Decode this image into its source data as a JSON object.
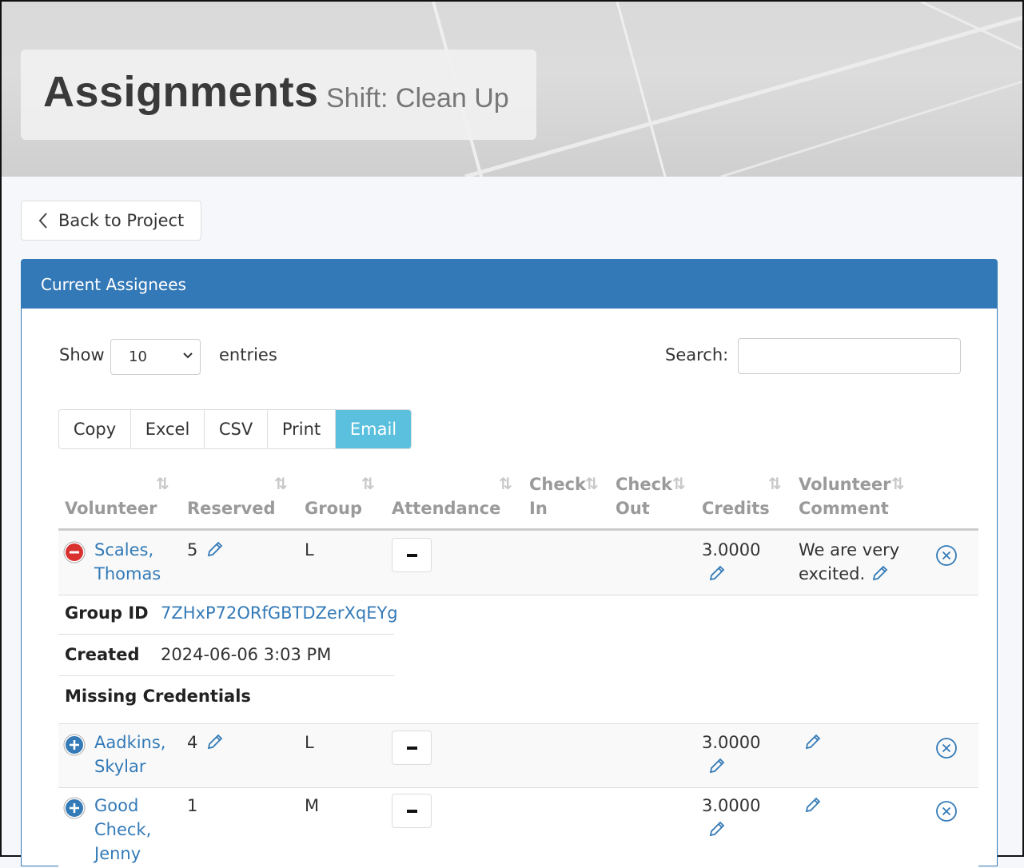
{
  "header": {
    "title": "Assignments",
    "subtitle": "Shift: Clean Up"
  },
  "nav": {
    "back_label": "Back to Project"
  },
  "panel": {
    "title": "Current Assignees"
  },
  "controls": {
    "show_label": "Show",
    "show_value": "10",
    "entries_label": "entries",
    "search_label": "Search:",
    "search_value": ""
  },
  "export_buttons": [
    {
      "label": "Copy"
    },
    {
      "label": "Excel"
    },
    {
      "label": "CSV"
    },
    {
      "label": "Print"
    },
    {
      "label": "Email",
      "active": true
    }
  ],
  "columns": [
    {
      "line1": "",
      "line2": "Volunteer"
    },
    {
      "line1": "",
      "line2": "Reserved"
    },
    {
      "line1": "",
      "line2": "Group"
    },
    {
      "line1": "",
      "line2": "Attendance"
    },
    {
      "line1": "Check",
      "line2": "In"
    },
    {
      "line1": "Check",
      "line2": "Out"
    },
    {
      "line1": "",
      "line2": "Credits"
    },
    {
      "line1": "Volunteer",
      "line2": "Comment"
    }
  ],
  "rows": [
    {
      "name_line1": "Scales,",
      "name_line2": "Thomas",
      "reserved": "5",
      "group": "L",
      "credits": "3.0000",
      "comment_line1": "We are very",
      "comment_line2": "excited.",
      "expanded": true
    },
    {
      "name_line1": "Aadkins,",
      "name_line2": "Skylar",
      "reserved": "4",
      "group": "L",
      "credits": "3.0000",
      "comment_line1": "",
      "comment_line2": "",
      "expanded": false
    },
    {
      "name_line1": "Good",
      "name_line2": "Check,",
      "name_line3": "Jenny",
      "reserved": "1",
      "group": "M",
      "credits": "3.0000",
      "comment_line1": "",
      "comment_line2": "",
      "expanded": false
    }
  ],
  "details": {
    "group_id_label": "Group ID",
    "group_id_value": "7ZHxP72ORfGBTDZerXqEYg",
    "created_label": "Created",
    "created_value": "2024-06-06 3:03 PM",
    "missing_label": "Missing Credentials"
  },
  "colors": {
    "accent": "#3479b7",
    "email_button": "#5bc0de",
    "remove_red": "#d9312d",
    "expand_blue": "#337ab7"
  },
  "icons": [
    "chevron-left-icon",
    "caret-down-icon",
    "sort-icon",
    "minus-circle-icon",
    "plus-circle-icon",
    "pencil-icon",
    "close-circle-icon"
  ]
}
